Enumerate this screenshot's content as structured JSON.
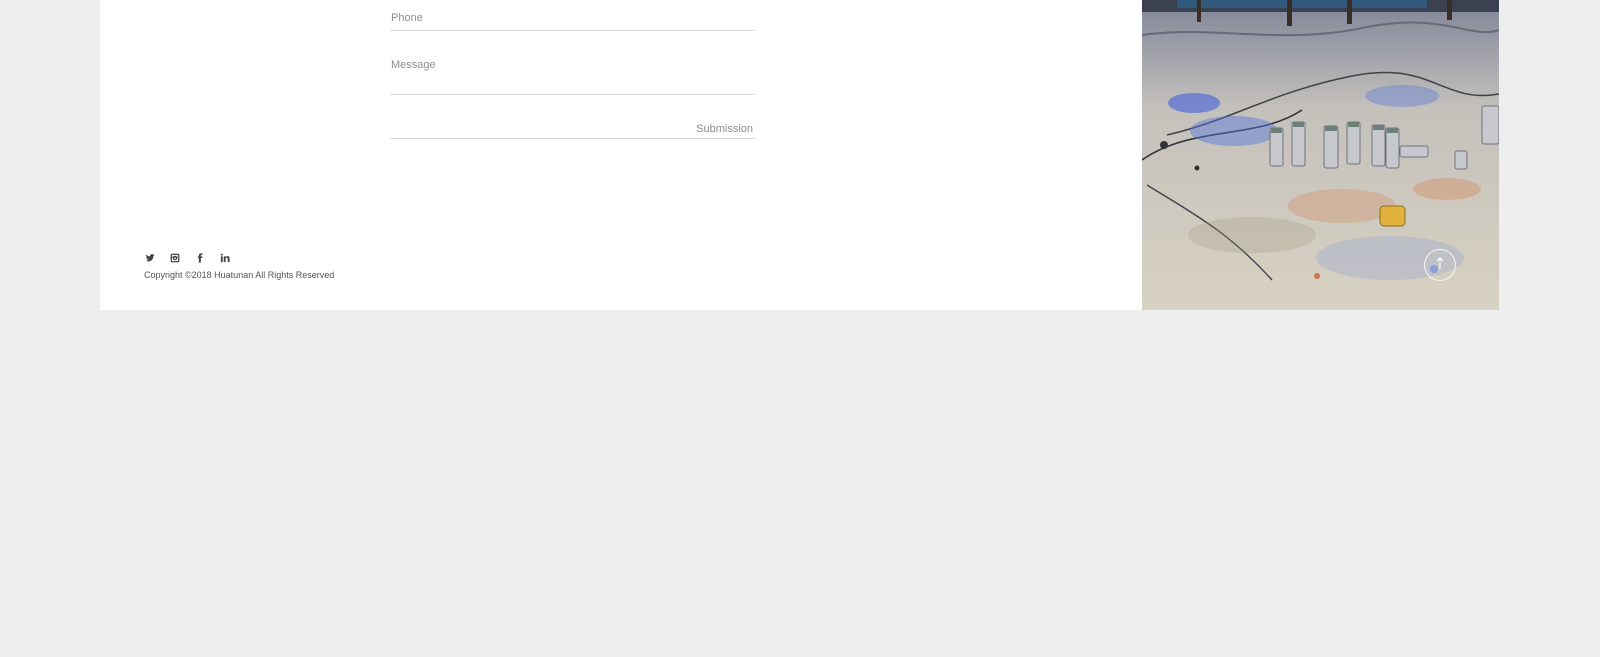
{
  "form": {
    "phone_placeholder": "Phone",
    "message_placeholder": "Message",
    "submit_label": "Submission"
  },
  "footer": {
    "social_icons": [
      "twitter-icon",
      "instagram-icon",
      "facebook-icon",
      "linkedin-icon"
    ],
    "copyright": "Copyright ©2018 Huatunan All Rights Reserved"
  },
  "back_to_top": {
    "icon": "arrow-up-icon"
  },
  "colors": {
    "background": "#eeeeee",
    "card": "#ffffff",
    "muted_text": "#8e8e8e",
    "line": "#dcdcdc"
  }
}
